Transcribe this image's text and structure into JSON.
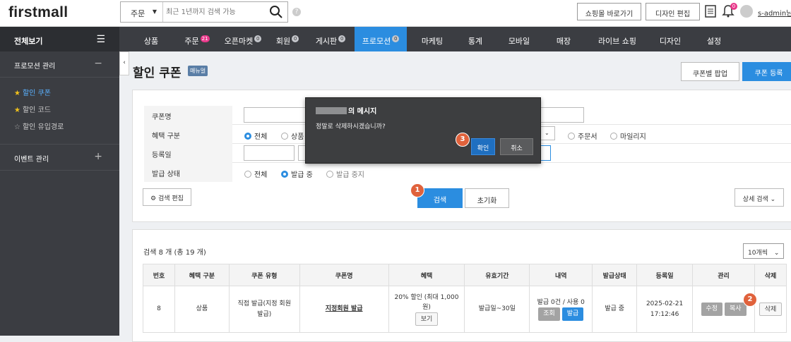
{
  "header": {
    "logo": "firstmall",
    "search_scope": "주문",
    "search_placeholder": "최근 1년까지 검색 가능",
    "help": "?",
    "shop_button": "쇼핑몰 바로가기",
    "design_button": "디자인 편집",
    "notif_count": "0",
    "username": "s-admin",
    "username_suffix": "님"
  },
  "sidebar": {
    "all_view": "전체보기",
    "section1": "프로모션 관리",
    "section1_ctl": "−",
    "items": [
      {
        "label": "할인 쿠폰",
        "star": "★"
      },
      {
        "label": "할인 코드",
        "star": "★"
      },
      {
        "label": "할인 유입경로",
        "star": "☆"
      }
    ],
    "section2": "이벤트 관리",
    "section2_ctl": "+"
  },
  "nav": {
    "items": [
      {
        "label": "상품",
        "badge": ""
      },
      {
        "label": "주문",
        "badge": "21"
      },
      {
        "label": "오픈마켓",
        "badge": "0"
      },
      {
        "label": "회원",
        "badge": "0"
      },
      {
        "label": "게시판",
        "badge": "0"
      },
      {
        "label": "프로모션",
        "badge": "0"
      },
      {
        "label": "마케팅",
        "badge": ""
      },
      {
        "label": "통계",
        "badge": ""
      },
      {
        "label": "모바일",
        "badge": ""
      },
      {
        "label": "매장",
        "badge": ""
      },
      {
        "label": "라이브 쇼핑",
        "badge": ""
      },
      {
        "label": "디자인",
        "badge": ""
      },
      {
        "label": "설정",
        "badge": ""
      }
    ],
    "active": "프로모션"
  },
  "page": {
    "title": "할인 쿠폰",
    "manual_badge": "매뉴얼",
    "popup_button": "쿠폰별 팝업",
    "register_button": "쿠폰 등록"
  },
  "filters": {
    "coupon_name_label": "쿠폰명",
    "benefit_label": "혜택 구분",
    "benefit_options": [
      "전체",
      "상품",
      "주문서",
      "마일리지"
    ],
    "regdate_label": "등록일",
    "issue_label": "발급 상태",
    "issue_options": [
      "전체",
      "발급 중",
      "발급 중지"
    ],
    "edit_search": "검색 편집",
    "search": "검색",
    "reset": "초기화",
    "detail_search": "상세 검색"
  },
  "results": {
    "count_text": "검색 8 개 (총 19 개)",
    "per_page": "10개씩",
    "columns": [
      "번호",
      "혜택 구분",
      "쿠폰 유형",
      "쿠폰명",
      "혜택",
      "유효기간",
      "내역",
      "발급상태",
      "등록일",
      "관리",
      "삭제"
    ],
    "row": {
      "no": "8",
      "benefit_type": "상품",
      "coupon_type_1": "직접 발급(지정 회원",
      "coupon_type_2": "발급)",
      "name": "지정회원 발급",
      "benefit_1": "20% 할인 (최대 1,000",
      "benefit_2": "원)",
      "view_btn": "보기",
      "validity": "발급일~30일",
      "history": "발급 0건 / 사용 0",
      "lookup_btn": "조회",
      "issue_btn": "발급",
      "status": "발급 중",
      "date": "2025-02-21",
      "time": "17:12:46",
      "edit_btn": "수정",
      "copy_btn": "복사",
      "delete_btn": "삭제"
    }
  },
  "dialog": {
    "title_suffix": "의 메시지",
    "message": "정말로 삭제하시겠습니까?",
    "ok": "확인",
    "cancel": "취소"
  },
  "steps": [
    "1",
    "2",
    "3"
  ],
  "colors": {
    "accent": "#2b8de0",
    "step": "#e0623c",
    "badge": "#e8388a"
  }
}
